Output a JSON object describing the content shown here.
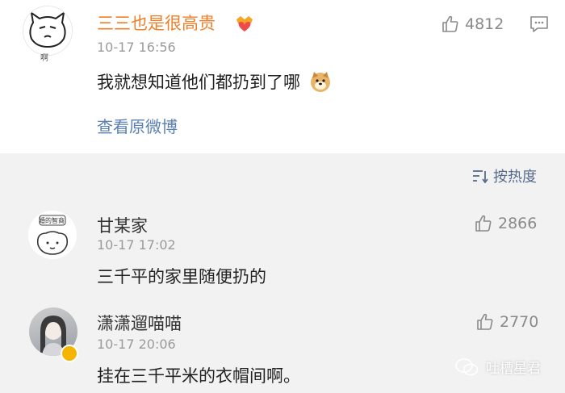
{
  "top_comment": {
    "username": "三三也是很高贵",
    "avatar_caption": "啊",
    "time": "10-17 16:56",
    "text": "我就想知道他们都扔到了哪",
    "likes": "4812",
    "view_original": "查看原微博"
  },
  "sort": {
    "label": "按热度"
  },
  "replies": [
    {
      "username": "甘某家",
      "avatar_caption": "婚的智商",
      "time": "10-17 17:02",
      "text": "三千平的家里随便扔的",
      "likes": "2866"
    },
    {
      "username": "潇潇遛喵喵",
      "time": "10-17 20:06",
      "text": "挂在三千平米的衣帽间啊。",
      "likes": "2770"
    }
  ],
  "watermark": {
    "text": "吐槽星君"
  },
  "colors": {
    "vip_name": "#f07f2a",
    "link": "#5a80b3",
    "bg": "#f2f2f2"
  }
}
